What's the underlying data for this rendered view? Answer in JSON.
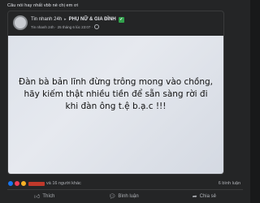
{
  "post": {
    "caption": "Câu nói hay nhất vbb nè chị em ơi",
    "shared": {
      "page_name": "Tin nhanh 24h",
      "arrow": "▸",
      "group_name": "PHỤ NỮ & GIA ĐÌNH",
      "verified_icon": "check-icon",
      "meta": "Tin nhanh 24h · 25 tháng 6 lúc 23:07 ·",
      "privacy_icon": "globe-icon",
      "image_text": "Đàn bà bản lĩnh đừng trông mong vào chồng, hãy kiếm thật nhiều tiền để sẵn sàng rời đi khi đàn ông t.ệ b.ạ.c !!!"
    },
    "reactions": {
      "others": "và 16 người khác",
      "comments": "6 bình luận"
    },
    "actions": {
      "like": "Thích",
      "comment": "Bình luận",
      "share": "Chia sẻ"
    }
  },
  "colors": {
    "background": "#242526",
    "verified": "#31a24c",
    "like": "#1877f2",
    "love": "#f33e58",
    "haha": "#f7b125"
  }
}
